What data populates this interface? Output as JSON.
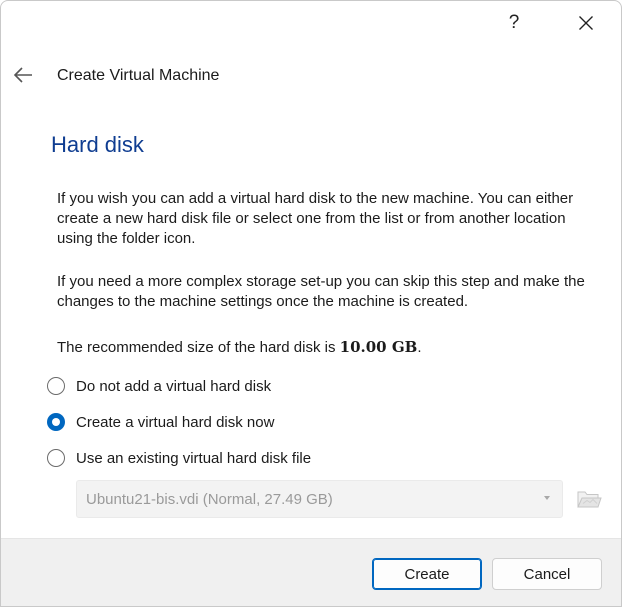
{
  "window": {
    "help_label": "?"
  },
  "header": {
    "title": "Create Virtual Machine"
  },
  "section": {
    "title": "Hard disk"
  },
  "description": {
    "paragraph1": "If you wish you can add a virtual hard disk to the new machine. You can either create a new hard disk file or select one from the list or from another location using the folder icon.",
    "paragraph2": "If you need a more complex storage set-up you can skip this step and make the changes to the machine settings once the machine is created.",
    "recommended_prefix": "The recommended size of the hard disk is ",
    "recommended_size": "10.00 GB",
    "recommended_suffix": "."
  },
  "options": [
    {
      "label": "Do not add a virtual hard disk",
      "checked": false
    },
    {
      "label": "Create a virtual hard disk now",
      "checked": true
    },
    {
      "label": "Use an existing virtual hard disk file",
      "checked": false
    }
  ],
  "existing_disk": {
    "selected_value": "Ubuntu21-bis.vdi (Normal, 27.49 GB)",
    "enabled": false,
    "folder_icon": "folder-open-icon"
  },
  "buttons": {
    "create_label": "Create",
    "cancel_label": "Cancel"
  },
  "colors": {
    "accent": "#0067c0",
    "section_title": "#0f3d91",
    "footer_bg": "#f0f0f0",
    "disabled_text": "#9a9a9a"
  }
}
